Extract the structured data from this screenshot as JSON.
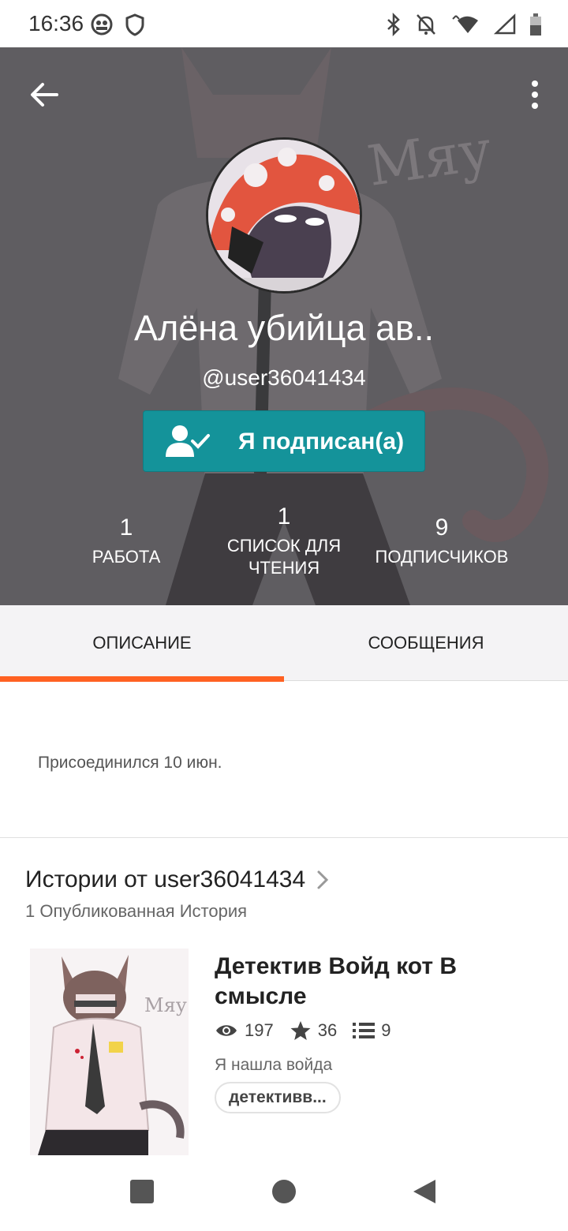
{
  "status_bar": {
    "time": "16:36"
  },
  "profile": {
    "name": "Алёна убийца ав..",
    "handle": "@user36041434",
    "follow_label": "Я подписан(а)",
    "header_watermark": "Мяу"
  },
  "stats": [
    {
      "value": "1",
      "label": "РАБОТА"
    },
    {
      "value": "1",
      "label_line1": "СПИСОК ДЛЯ",
      "label_line2": "ЧТЕНИЯ"
    },
    {
      "value": "9",
      "label": "ПОДПИСЧИКОВ"
    }
  ],
  "tabs": [
    {
      "label": "ОПИСАНИЕ",
      "active": true
    },
    {
      "label": "СООБЩЕНИЯ",
      "active": false
    }
  ],
  "about": {
    "joined": "Присоединился 10 июн."
  },
  "stories": {
    "title": "Истории от user36041434",
    "count_text": "1 Опубликованная История",
    "items": [
      {
        "title": "Детектив Войд кот В смысле",
        "reads": "197",
        "votes": "36",
        "parts": "9",
        "description": "Я нашла войда",
        "tag": "детективв...",
        "cover_watermark": "Мяу"
      }
    ]
  },
  "colors": {
    "accent": "#ff6122",
    "follow_button": "#14939a",
    "header_overlay": "#5f5d61"
  }
}
